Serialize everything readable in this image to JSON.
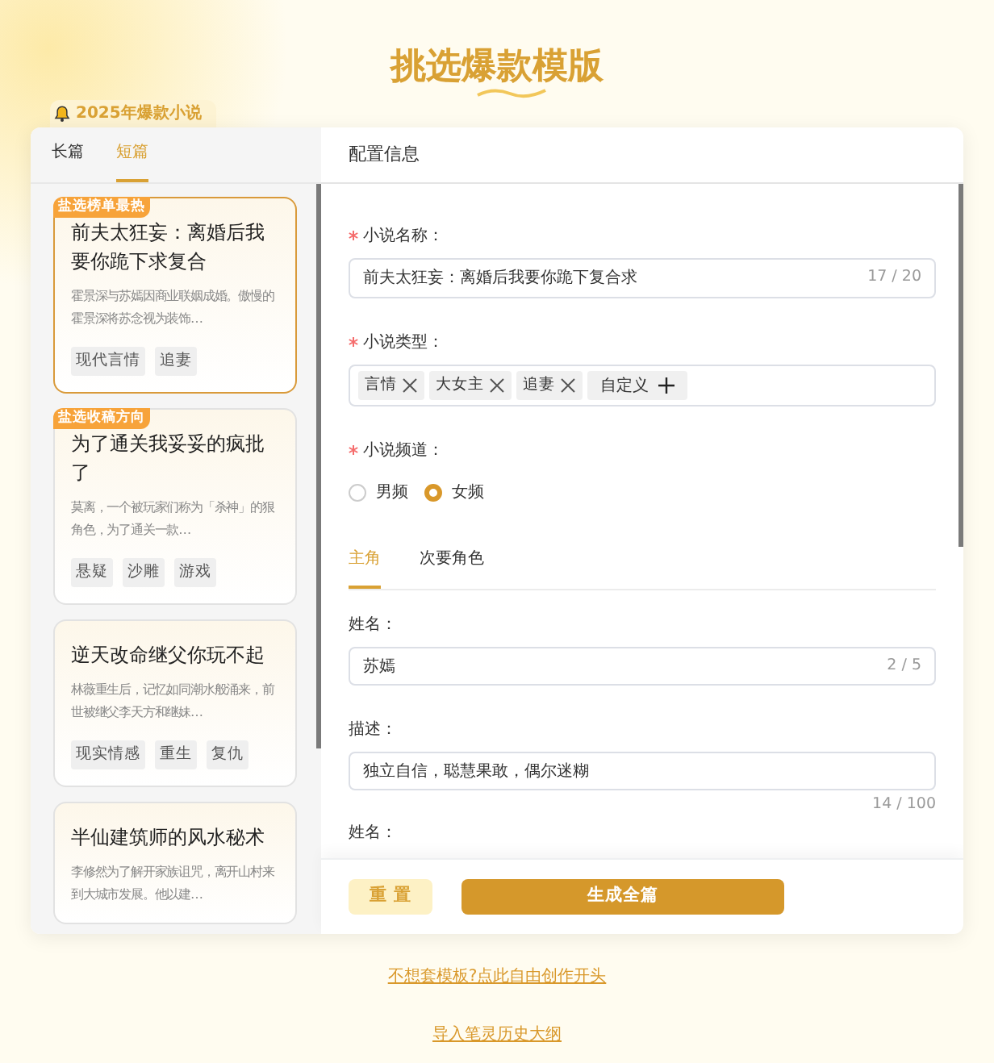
{
  "page_title": "挑选爆款模版",
  "banner": {
    "label": "2025年爆款小说"
  },
  "category_tabs": [
    {
      "label": "长篇",
      "selected": false
    },
    {
      "label": "短篇",
      "selected": true
    }
  ],
  "novels": [
    {
      "badge": "盐选榜单最热",
      "title": "前夫太狂妄：离婚后我要你跪下求复合",
      "summary": "霍景深与苏嫣因商业联姻成婚。傲慢的霍景深将苏念视为装饰…",
      "tags": [
        "现代言情",
        "追妻"
      ],
      "selected": true
    },
    {
      "badge": "盐选收稿方向",
      "title": "为了通关我妥妥的疯批了",
      "summary": "莫离，一个被玩家们称为「杀神」的狠角色，为了通关一款…",
      "tags": [
        "悬疑",
        "沙雕",
        "游戏"
      ],
      "selected": false
    },
    {
      "title": "逆天改命继父你玩不起",
      "summary": "林薇重生后，记忆如同潮水般涌来，前世被继父李天方和继妹…",
      "tags": [
        "现实情感",
        "重生",
        "复仇"
      ],
      "selected": false
    },
    {
      "title": "半仙建筑师的风水秘术",
      "summary": "李修然为了解开家族诅咒，离开山村来到大城市发展。他以建…",
      "selected": false
    }
  ],
  "config": {
    "heading": "配置信息",
    "name_field": {
      "label": "小说名称：",
      "required": true,
      "value": "前夫太狂妄：离婚后我要你跪下复合求",
      "count": "17 / 20"
    },
    "type_field": {
      "label": "小说类型：",
      "required": true,
      "tags": [
        "言情",
        "大女主",
        "追妻"
      ],
      "custom_button": "自定义"
    },
    "channel_field": {
      "label": "小说频道：",
      "required": true,
      "options": [
        {
          "label": "男频",
          "selected": false
        },
        {
          "label": "女频",
          "selected": true
        }
      ]
    },
    "role_tabs": [
      {
        "label": "主角",
        "selected": true
      },
      {
        "label": "次要角色",
        "selected": false
      }
    ],
    "role_fields": [
      {
        "kind": "input",
        "label": "姓名：",
        "value": "苏嫣",
        "count": "2 / 5"
      },
      {
        "kind": "textarea",
        "label": "描述：",
        "value": "独立自信，聪慧果敢，偶尔迷糊",
        "count": "14 / 100"
      },
      {
        "kind": "label",
        "label": "姓名："
      }
    ]
  },
  "buttons": {
    "reset": "重 置",
    "generate": "生成全篇"
  },
  "links": [
    "不想套模板?点此自由创作开头",
    "导入笔灵历史大纲"
  ]
}
